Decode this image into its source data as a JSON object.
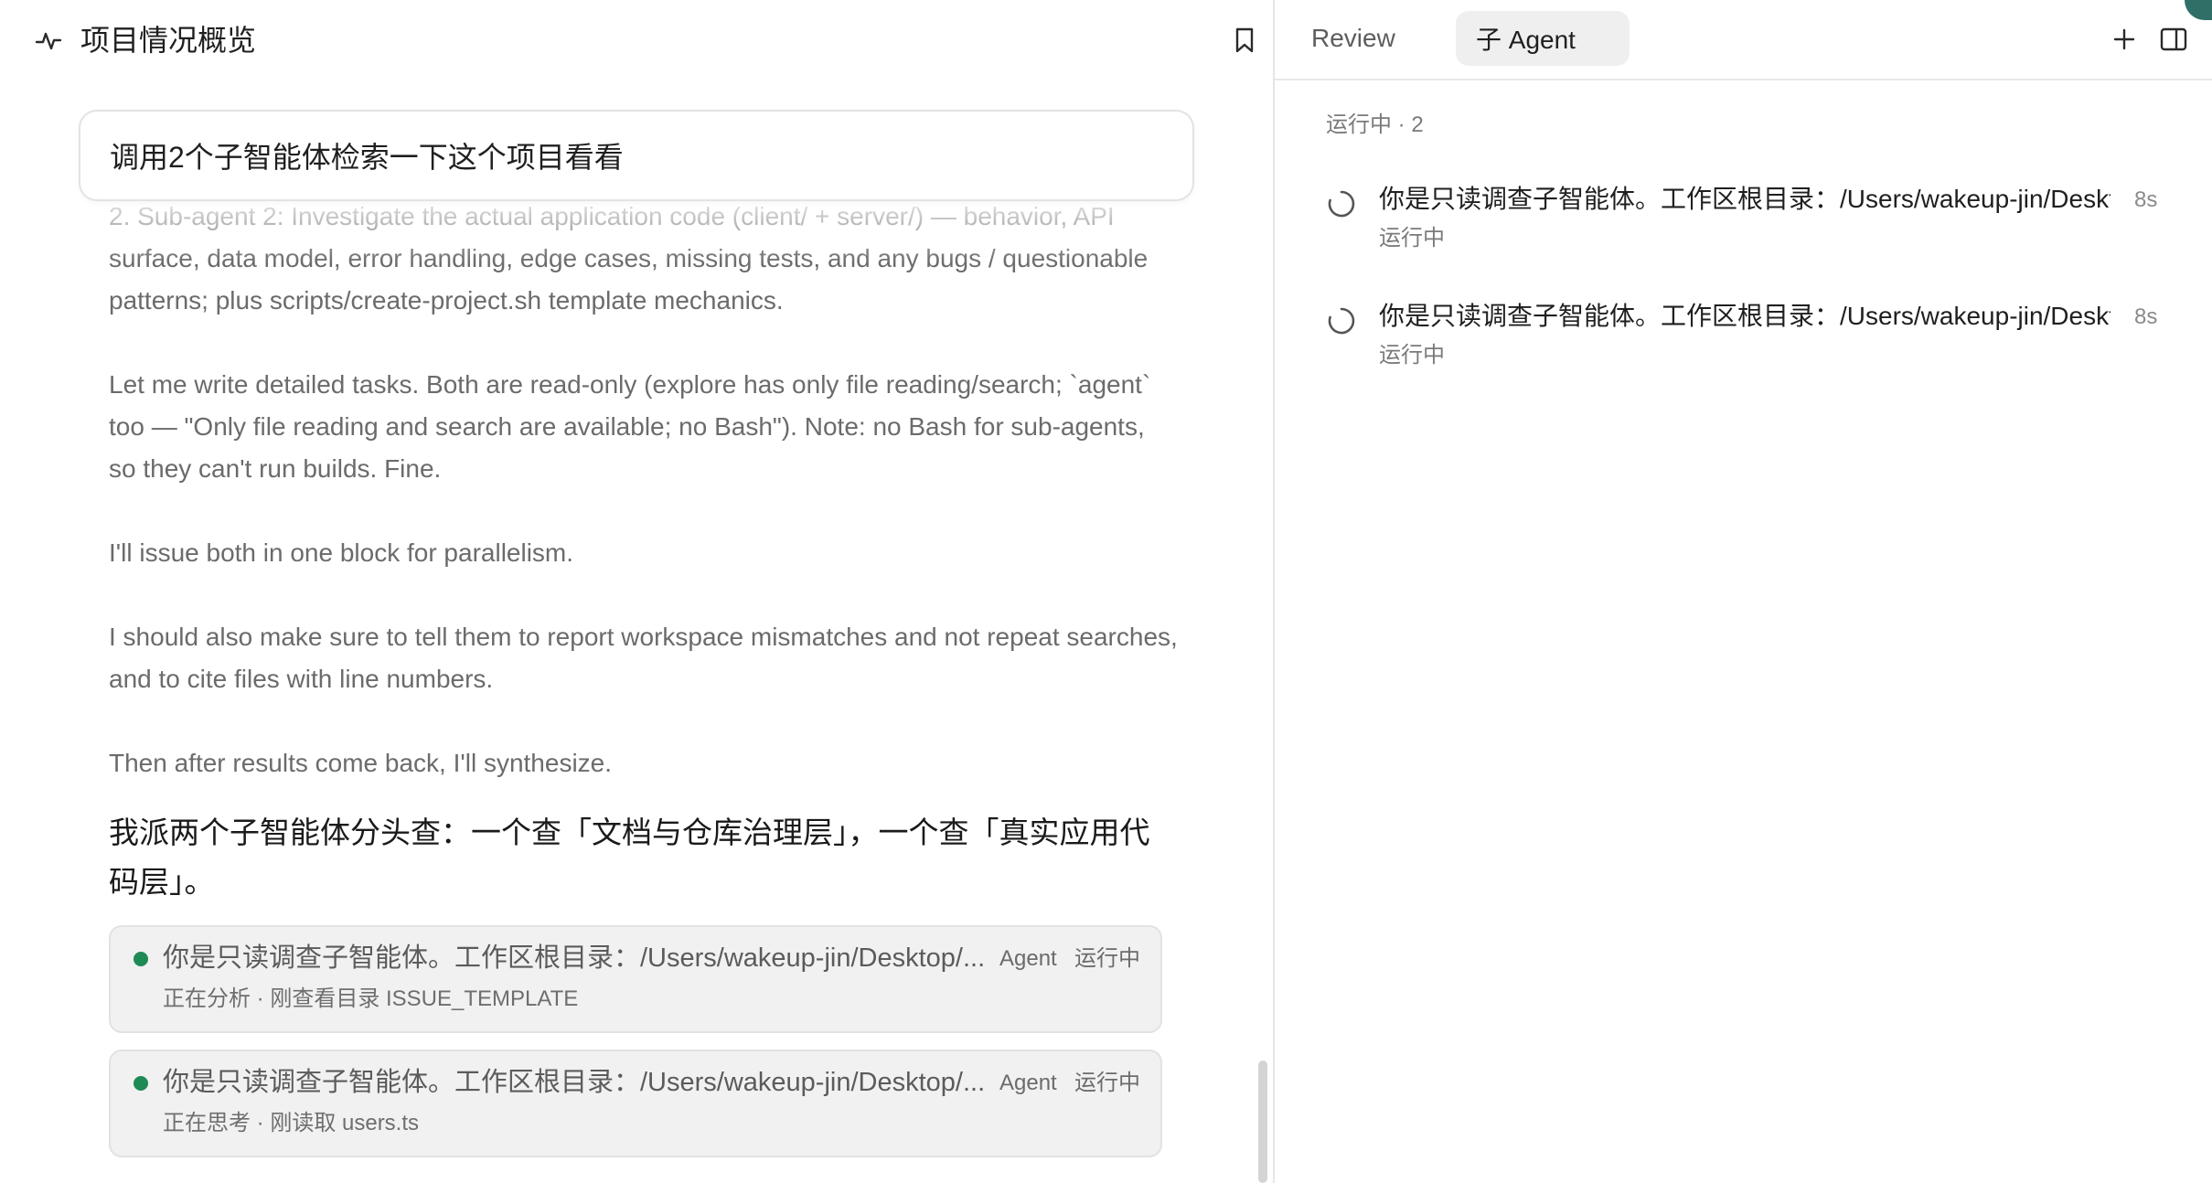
{
  "left": {
    "title": "项目情况概览",
    "prompt": "调用2个子智能体检索一下这个项目看看",
    "thinking": [
      "2. Sub-agent 2: Investigate the actual application code (client/ + server/) — behavior, API surface, data model, error handling, edge cases, missing tests, and any bugs / questionable patterns; plus scripts/create-project.sh template mechanics.",
      "Let me write detailed tasks. Both are read-only (explore has only file reading/search; `agent` too — \"Only file reading and search are available; no Bash\"). Note: no Bash for sub-agents, so they can't run builds. Fine.",
      "I'll issue both in one block for parallelism.",
      "I should also make sure to tell them to report workspace mismatches and not repeat searches, and to cite files with line numbers.",
      "Then after results come back, I'll synthesize."
    ],
    "answer": "我派两个子智能体分头查：一个查「文档与仓库治理层」，一个查「真实应用代码层」。",
    "cards": [
      {
        "title": "你是只读调查子智能体。工作区根目录：/Users/wakeup-jin/Desktop/...",
        "tag": "Agent",
        "status": "运行中",
        "sub": "正在分析 · 刚查看目录 ISSUE_TEMPLATE",
        "dot_color": "#1e8a55"
      },
      {
        "title": "你是只读调查子智能体。工作区根目录：/Users/wakeup-jin/Desktop/...",
        "tag": "Agent",
        "status": "运行中",
        "sub": "正在思考 · 刚读取 users.ts",
        "dot_color": "#1e8a55"
      }
    ]
  },
  "right": {
    "tabs": [
      {
        "label": "Review",
        "active": false
      },
      {
        "label": "子 Agent",
        "active": true
      }
    ],
    "section_label": "运行中 · 2",
    "agents": [
      {
        "title": "你是只读调查子智能体。工作区根目录：/Users/wakeup-jin/Deskto...",
        "time": "8s",
        "status": "运行中"
      },
      {
        "title": "你是只读调查子智能体。工作区根目录：/Users/wakeup-jin/Deskto...",
        "time": "8s",
        "status": "运行中"
      }
    ]
  },
  "icons": {
    "header": "activity-icon",
    "bookmark": "bookmark-icon",
    "plus": "plus-icon",
    "panel": "panel-toggle-icon",
    "spinner": "spinner-icon",
    "status_dot": "status-dot-icon"
  },
  "colors": {
    "accent_green": "#1e8a55",
    "corner_accent": "#2f6f68"
  }
}
